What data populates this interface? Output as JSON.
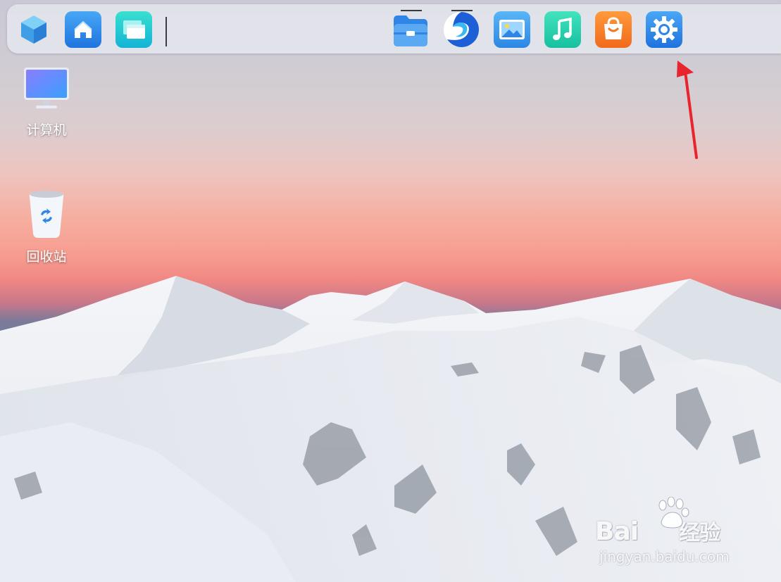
{
  "dock": {
    "left_items": [
      {
        "name": "start-menu",
        "icon": "cube-logo-icon"
      },
      {
        "name": "home",
        "icon": "home-icon"
      },
      {
        "name": "multitask-view",
        "icon": "windows-stack-icon"
      }
    ],
    "center_items": [
      {
        "name": "file-manager",
        "icon": "folder-icon",
        "running": true
      },
      {
        "name": "browser",
        "icon": "browser-icon",
        "running": true
      },
      {
        "name": "image-viewer",
        "icon": "picture-icon",
        "running": false
      },
      {
        "name": "music",
        "icon": "music-note-icon",
        "running": false
      },
      {
        "name": "app-store",
        "icon": "shopping-bag-icon",
        "running": false
      },
      {
        "name": "control-center",
        "icon": "gear-icon",
        "running": false
      }
    ]
  },
  "desktop": {
    "icons": [
      {
        "label": "计算机",
        "icon": "monitor-icon"
      },
      {
        "label": "回收站",
        "icon": "trash-bin-icon"
      }
    ]
  },
  "annotation": {
    "icon": "red-arrow-icon",
    "color": "#e8242c",
    "target": "control-center"
  },
  "watermark": {
    "brand": "Bai",
    "brand_suffix": "经验",
    "site": "jingyan.baidu.com"
  },
  "colors": {
    "accent_blue": "#3a8ee8",
    "orange": "#f57a23",
    "teal": "#1fd8b0"
  }
}
